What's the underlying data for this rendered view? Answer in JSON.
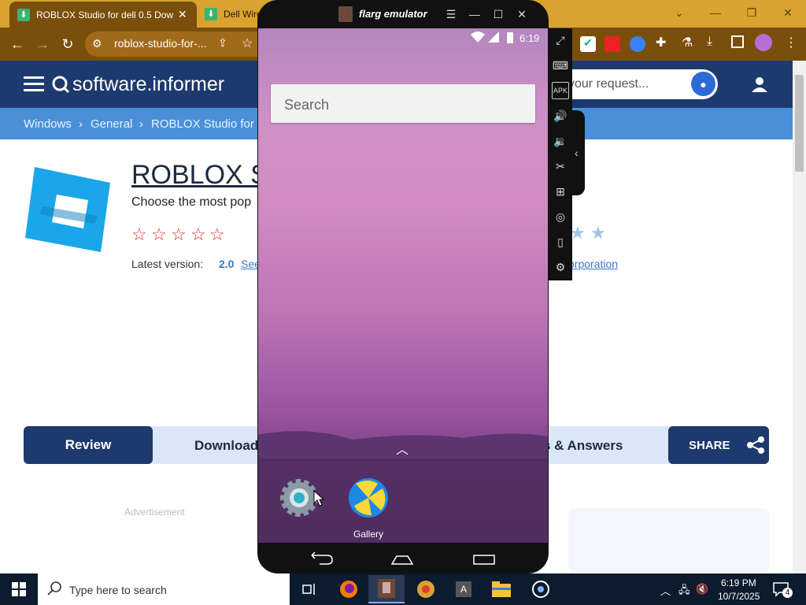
{
  "browser": {
    "tabs": [
      {
        "label": "ROBLOX Studio for dell 0.5 Dow",
        "active": true
      },
      {
        "label": "Dell Wire",
        "active": false
      }
    ],
    "url": "roblox-studio-for-..."
  },
  "site": {
    "logo": "software.informer",
    "search_placeholder": "your request...",
    "breadcrumb": [
      "Windows",
      "General",
      "ROBLOX Studio for d"
    ],
    "app_title": "ROBLOX St",
    "app_subtitle": "Choose the most pop",
    "latest_label": "Latest version:",
    "latest_value": "2.0",
    "see_link": "See",
    "publisher_link": "orporation",
    "tabs": {
      "review": "Review",
      "download": "Download",
      "answers": "s & Answers",
      "share": "SHARE"
    },
    "advertisement": "Advertisement"
  },
  "emulator": {
    "title": "flarg emulator",
    "status_time": "6:19",
    "search_placeholder": "Search",
    "apps": [
      {
        "name": "Settings",
        "label": ""
      },
      {
        "name": "Gallery",
        "label": "Gallery"
      }
    ],
    "side_toolbar": [
      "fullscreen-icon",
      "keyboard-icon",
      "apk-icon",
      "volume-up-icon",
      "volume-down-icon",
      "scissors-icon",
      "add-screen-icon",
      "location-icon",
      "shake-icon",
      "settings-icon"
    ]
  },
  "taskbar": {
    "search_placeholder": "Type here to search",
    "time": "6:19 PM",
    "date": "10/7/2025",
    "notification_count": "4"
  },
  "colors": {
    "chrome_frame": "#d8a32f",
    "chrome_toolbar": "#7a4e0b",
    "site_header": "#1d3a6e",
    "breadcrumb_bar": "#4a90d9",
    "taskbar": "#0d1b2e"
  }
}
